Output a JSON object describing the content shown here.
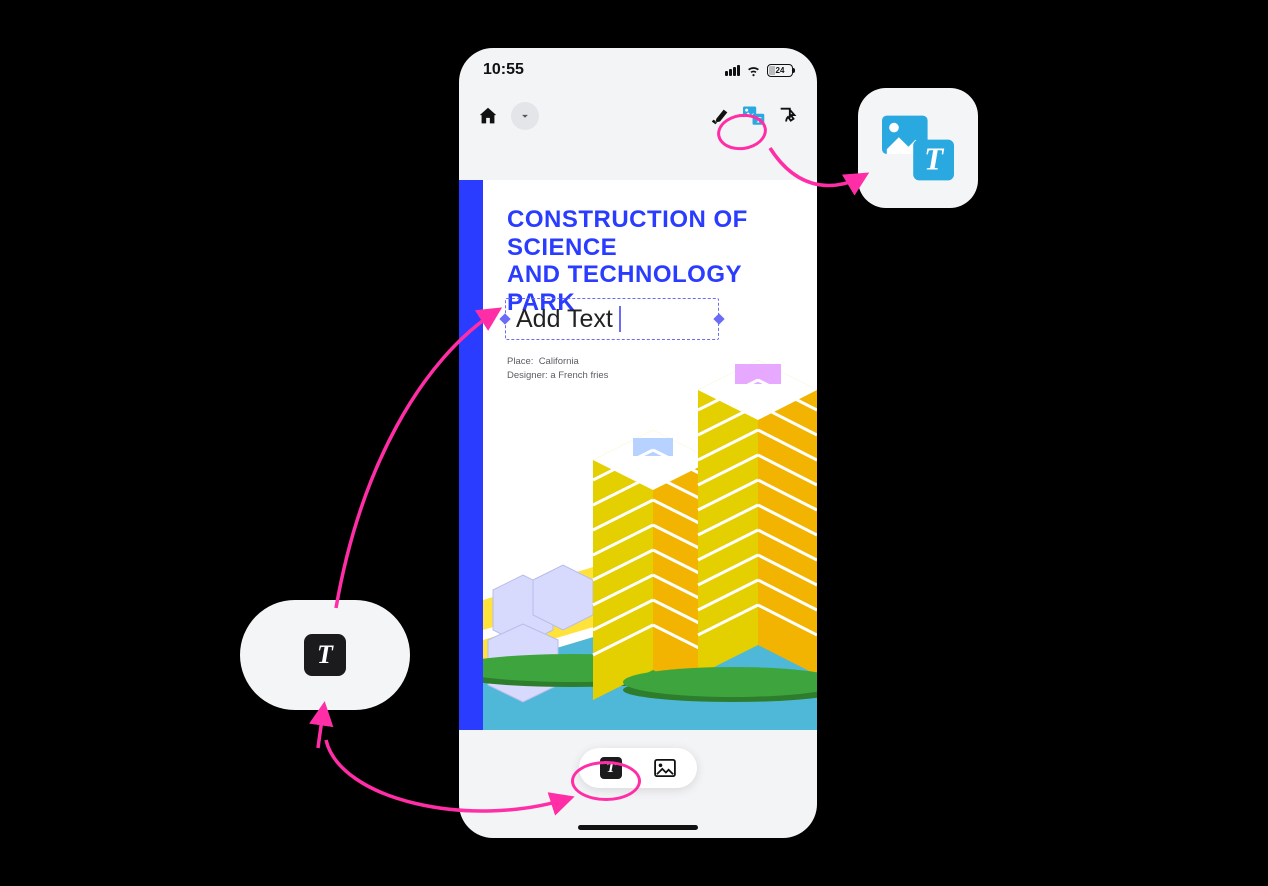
{
  "status": {
    "time": "10:55",
    "battery": "24"
  },
  "document": {
    "title_line1": "CONSTRUCTION OF SCIENCE",
    "title_line2": "AND TECHNOLOGY PARK",
    "add_text_placeholder": "Add Text",
    "meta_place_label": "Place:",
    "meta_place_value": "California",
    "meta_designer_label": "Designer:",
    "meta_designer_value": "a French fries"
  },
  "toolbar": {
    "home_icon": "home",
    "dropdown_icon": "chevron-down",
    "highlighter_icon": "highlighter",
    "image_text_icon": "image-text",
    "touch_icon": "touch-select"
  },
  "bottom_bar": {
    "text_tool": "text",
    "image_tool": "image"
  },
  "callouts": {
    "text_tool": "T",
    "image_text_tool": "image+T"
  },
  "colors": {
    "accent": "#2a3cff",
    "highlight_ring": "#ff2ea6",
    "callout_icon_blue": "#2aa9e0"
  }
}
